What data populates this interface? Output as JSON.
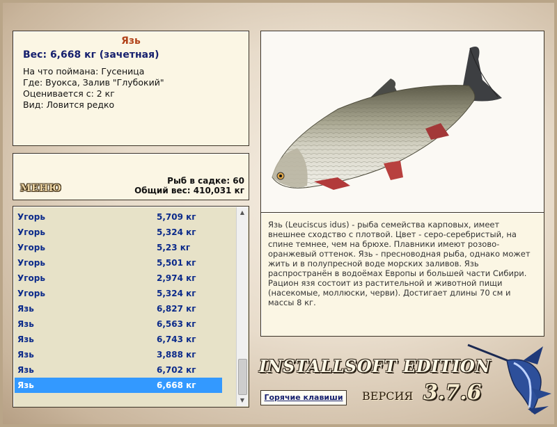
{
  "fish_info": {
    "name": "Язь",
    "weight_line": "Вес: 6,668 кг (зачетная)",
    "lines": [
      "На что поймана: Гусеница",
      "Где: Вуокса, Залив \"Глубокий\"",
      "Оценивается с: 2 кг",
      "Вид: Ловится редко"
    ]
  },
  "summary": {
    "menu_label": "МЕНЮ",
    "fish_count": "Рыб в садке: 60",
    "total_weight": "Общий вес: 410,031 кг"
  },
  "catch_list": [
    {
      "name": "Угорь",
      "weight": "5,709 кг"
    },
    {
      "name": "Угорь",
      "weight": "5,324 кг"
    },
    {
      "name": "Угорь",
      "weight": "5,23 кг"
    },
    {
      "name": "Угорь",
      "weight": "5,501 кг"
    },
    {
      "name": "Угорь",
      "weight": "2,974 кг"
    },
    {
      "name": "Угорь",
      "weight": "5,324 кг"
    },
    {
      "name": "Язь",
      "weight": "6,827 кг"
    },
    {
      "name": "Язь",
      "weight": "6,563 кг"
    },
    {
      "name": "Язь",
      "weight": "6,743 кг"
    },
    {
      "name": "Язь",
      "weight": "3,888 кг"
    },
    {
      "name": "Язь",
      "weight": "6,702 кг"
    },
    {
      "name": "Язь",
      "weight": "6,668 кг",
      "selected": true
    }
  ],
  "description": "Язь (Leuciscus idus) - рыба семейства карповых, имеет внешнее сходство с плотвой. Цвет - серо-серебристый, на спине темнее, чем на брюхе. Плавники имеют розово-оранжевый оттенок. Язь - пресноводная рыба, однако может жить и в полупресной воде морских заливов. Язь распространён в водоёмах Европы и большей части Сибири. Рацион язя состоит из растительной и животной пищи (насекомые, моллюски, черви). Достигает длины 70 см и массы 8 кг.",
  "footer": {
    "brand": "INSTALLSOFT EDITION",
    "hotkeys_label": "Горячие клавиши",
    "version_label": "ВЕРСИЯ",
    "version_number": "3.7.6"
  },
  "colors": {
    "title": "#b2431a",
    "weight": "#16206e",
    "list_text": "#0b2a8a",
    "selection": "#3399ff",
    "panel_bg": "#fbf6e4"
  },
  "icons": {
    "fish_image": "ide-fish-picture",
    "logo": "marlin-logo",
    "scroll_up": "arrow-up-icon",
    "scroll_down": "arrow-down-icon"
  }
}
